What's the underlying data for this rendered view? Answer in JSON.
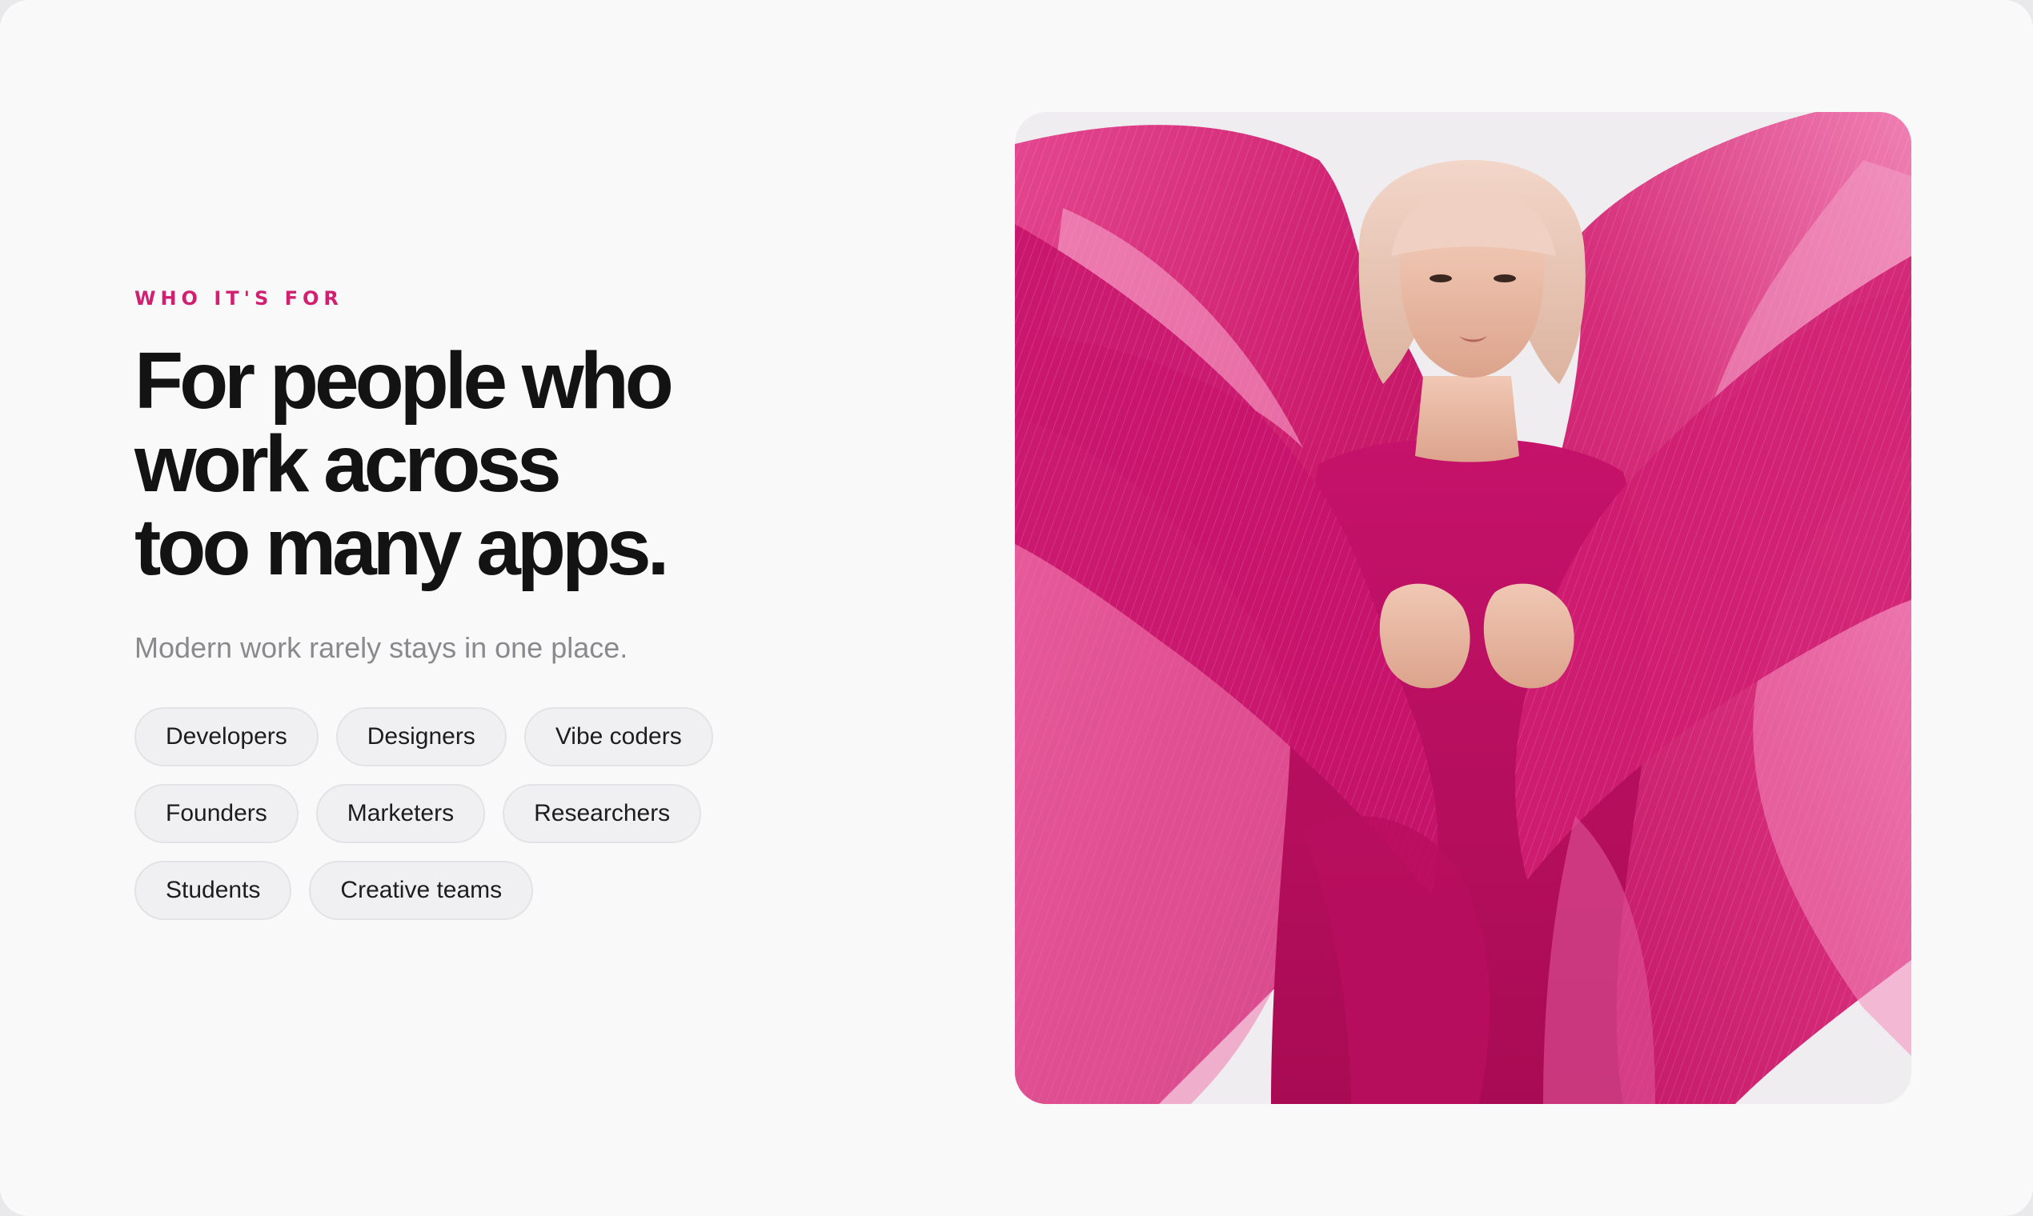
{
  "section": {
    "eyebrow": "WHO IT'S FOR",
    "headline_lines": [
      "For people who",
      "work across",
      "too many apps."
    ],
    "subhead": "Modern work rarely stays in one place."
  },
  "audiences": [
    [
      "Developers",
      "Designers",
      "Vibe coders"
    ],
    [
      "Founders",
      "Marketers",
      "Researchers"
    ],
    [
      "Students",
      "Creative teams"
    ]
  ],
  "image": {
    "subject": "woman in flowing magenta pleated fabric",
    "accent_color": "#d0206f"
  },
  "colors": {
    "accent": "#d0206f",
    "headline": "#131313",
    "subhead": "#8a8a8e",
    "chip_bg": "#f0f0f2",
    "page_bg": "#f9f9fa"
  }
}
